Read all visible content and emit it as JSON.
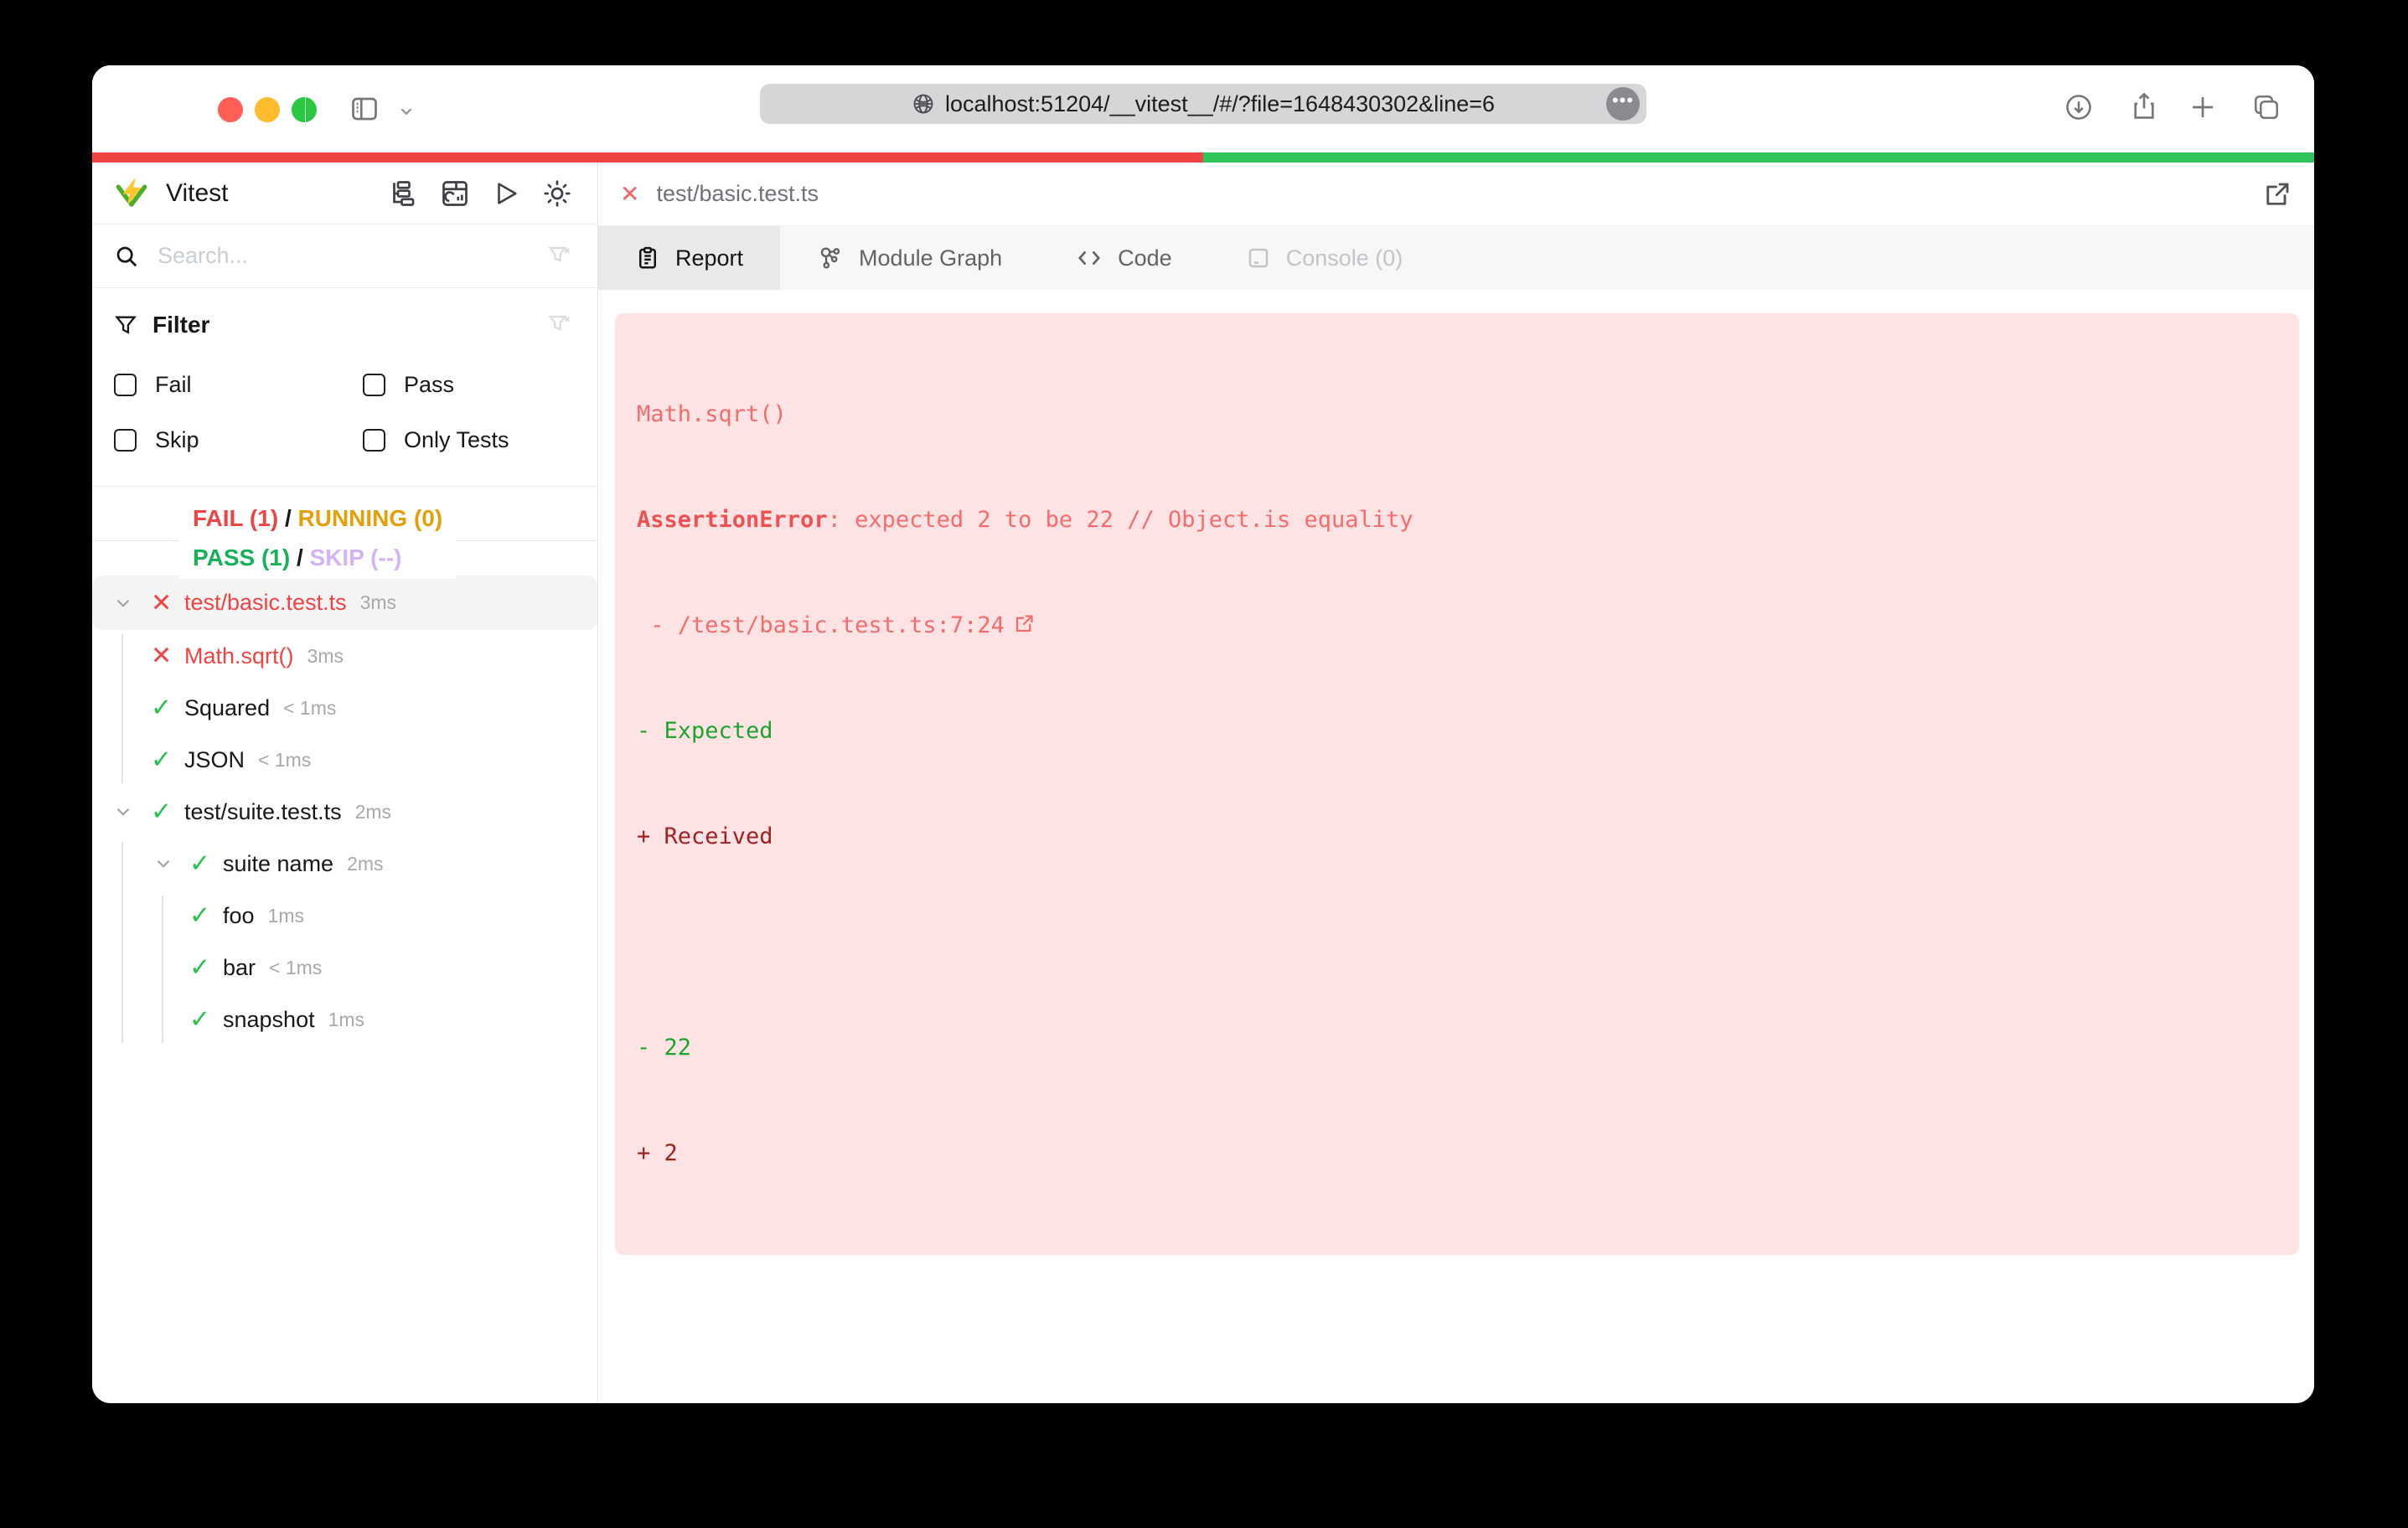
{
  "browser": {
    "url": "localhost:51204/__vitest__/#/?file=1648430302&line=6"
  },
  "progress": {
    "fail_color": "#ef4444",
    "pass_color": "#2fc45c",
    "fail_fraction": "50%"
  },
  "sidebar": {
    "app_title": "Vitest",
    "search_placeholder": "Search...",
    "filter": {
      "title": "Filter",
      "fail": "Fail",
      "pass": "Pass",
      "skip": "Skip",
      "only": "Only Tests"
    },
    "summary": {
      "fail": "FAIL (1)",
      "slash1": "/",
      "running": "RUNNING (0)",
      "pass": "PASS (1)",
      "slash2": "/",
      "skip": "SKIP (--)"
    },
    "tree": [
      {
        "label": "test/basic.test.ts",
        "duration": "3ms",
        "status": "fail"
      },
      {
        "label": "Math.sqrt()",
        "duration": "3ms",
        "status": "fail"
      },
      {
        "label": "Squared",
        "duration": "< 1ms",
        "status": "pass"
      },
      {
        "label": "JSON",
        "duration": "< 1ms",
        "status": "pass"
      },
      {
        "label": "test/suite.test.ts",
        "duration": "2ms",
        "status": "pass"
      },
      {
        "label": "suite name",
        "duration": "2ms",
        "status": "pass"
      },
      {
        "label": "foo",
        "duration": "1ms",
        "status": "pass"
      },
      {
        "label": "bar",
        "duration": "< 1ms",
        "status": "pass"
      },
      {
        "label": "snapshot",
        "duration": "1ms",
        "status": "pass"
      }
    ]
  },
  "icons": {
    "fail": "✕",
    "pass": "✓"
  },
  "main": {
    "file_tab": "test/basic.test.ts",
    "tabs": [
      {
        "label": "Report"
      },
      {
        "label": "Module Graph"
      },
      {
        "label": "Code"
      },
      {
        "label": "Console (0)"
      }
    ],
    "error": {
      "title": "Math.sqrt()",
      "error_name": "AssertionError",
      "error_message": ": expected 2 to be 22 // Object.is equality",
      "stack_prefix": " - ",
      "stack_link": "/test/basic.test.ts:7:24",
      "diff_expected_label": "- Expected",
      "diff_received_label": "+ Received",
      "diff_expected_value": "- 22",
      "diff_received_value": "+ 2"
    }
  },
  "colors": {
    "fail_red": "#ef4444",
    "running_amber": "#e3a008",
    "pass_green": "#16b158",
    "skip_purple": "#d5b3f7",
    "error_bg_pink": "#fde3e3",
    "diff_green": "#1ca42c",
    "diff_dark_red": "#a32020"
  }
}
